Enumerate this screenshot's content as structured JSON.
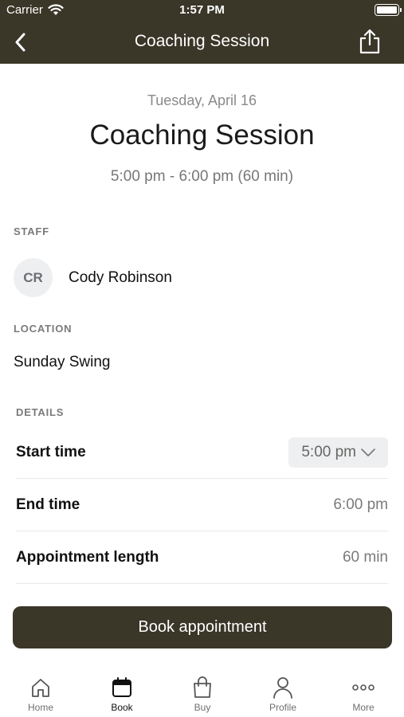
{
  "status_bar": {
    "carrier": "Carrier",
    "time": "1:57 PM"
  },
  "nav": {
    "title": "Coaching Session",
    "back_icon": "chevron-left-icon",
    "share_icon": "share-icon"
  },
  "session": {
    "date": "Tuesday, April 16",
    "title": "Coaching Session",
    "time_range": "5:00 pm - 6:00 pm (60 min)"
  },
  "staff": {
    "label": "STAFF",
    "initials": "CR",
    "name": "Cody Robinson"
  },
  "location": {
    "label": "LOCATION",
    "name": "Sunday Swing"
  },
  "details": {
    "label": "DETAILS",
    "start_label": "Start time",
    "start_value": "5:00 pm",
    "end_label": "End time",
    "end_value": "6:00 pm",
    "length_label": "Appointment length",
    "length_value": "60 min"
  },
  "book_button": "Book appointment",
  "tabs": [
    {
      "label": "Home",
      "icon": "home-icon",
      "active": false
    },
    {
      "label": "Book",
      "icon": "calendar-icon",
      "active": true
    },
    {
      "label": "Buy",
      "icon": "shopping-bag-icon",
      "active": false
    },
    {
      "label": "Profile",
      "icon": "person-icon",
      "active": false
    },
    {
      "label": "More",
      "icon": "more-dots-icon",
      "active": false
    }
  ],
  "colors": {
    "brand": "#3a3628",
    "muted": "#7a7a7a"
  }
}
